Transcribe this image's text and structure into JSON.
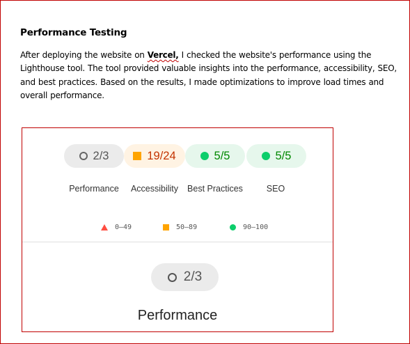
{
  "document": {
    "heading": "Performance Testing",
    "para_before": "After deploying  the website on ",
    "para_bold": "Vercel,",
    "para_after": " I checked the website's performance  using the Lighthouse tool. The tool provided  valuable insights into the performance,  accessibility, SEO, and best practices. Based on the results, I made optimizations  to improve  load times and overall performance."
  },
  "report": {
    "scores": [
      {
        "value": "2/3",
        "label": "Performance",
        "status": "neutral",
        "icon": "circle-outline-icon"
      },
      {
        "value": "19/24",
        "label": "Accessibility",
        "status": "average",
        "icon": "square-icon"
      },
      {
        "value": "5/5",
        "label": "Best Practices",
        "status": "pass",
        "icon": "circle-icon"
      },
      {
        "value": "5/5",
        "label": "SEO",
        "status": "pass",
        "icon": "circle-icon"
      }
    ],
    "legend": [
      {
        "range": "0–49",
        "icon": "triangle-icon",
        "color": "#ff4e42"
      },
      {
        "range": "50–89",
        "icon": "square-icon",
        "color": "#ffa400"
      },
      {
        "range": "90–100",
        "icon": "circle-icon",
        "color": "#0cce6b"
      }
    ],
    "detail": {
      "value": "2/3",
      "title": "Performance"
    }
  },
  "colors": {
    "border": "#c00000",
    "neutral_bg": "#ebebeb",
    "average_bg": "#fff3e3",
    "average_text": "#c33300",
    "pass_bg": "#e6f7ec",
    "pass_text": "#008800"
  }
}
